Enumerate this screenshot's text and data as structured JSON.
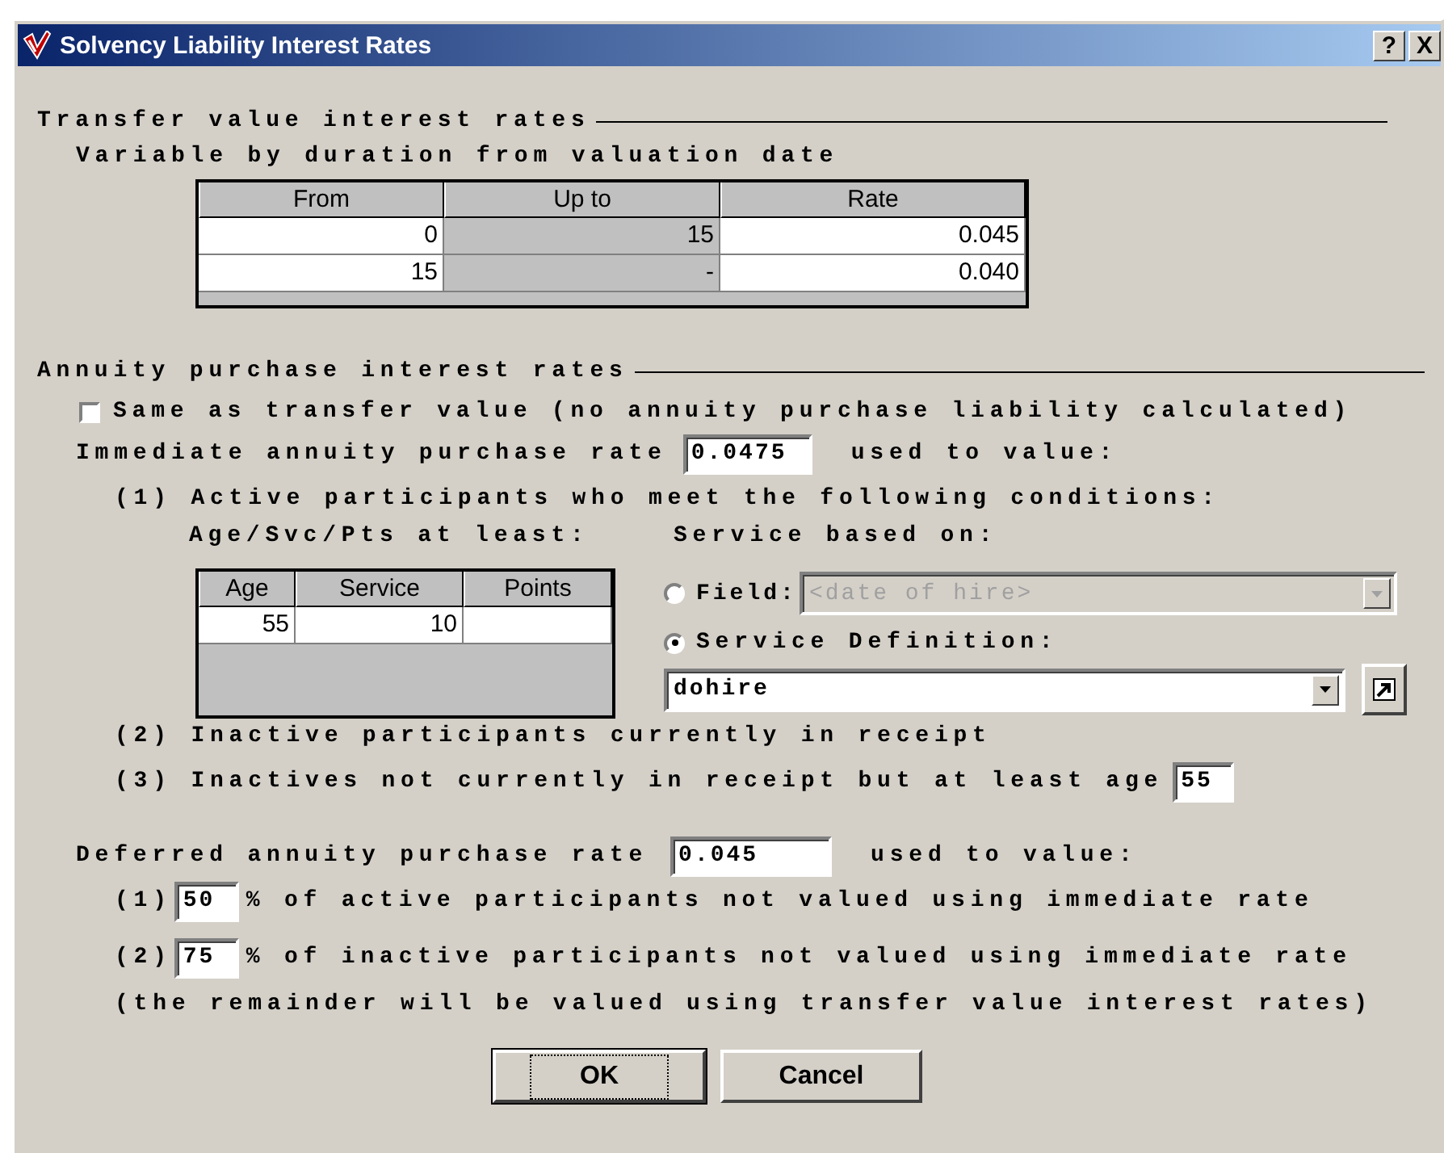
{
  "window": {
    "title": "Solvency Liability Interest Rates",
    "help_button": "?",
    "close_button": "X"
  },
  "transfer_section": {
    "heading": "Transfer value interest rates",
    "subheading": "Variable by duration from valuation date",
    "table": {
      "columns": [
        {
          "label": "From",
          "readonly": false
        },
        {
          "label": "Up to",
          "readonly": true
        },
        {
          "label": "Rate",
          "readonly": false
        }
      ],
      "rows": [
        [
          "0",
          "15",
          "0.045"
        ],
        [
          "15",
          "-",
          "0.040"
        ]
      ]
    }
  },
  "annuity_section": {
    "heading": "Annuity purchase interest rates",
    "same_as_transfer": {
      "label": "Same as transfer value (no annuity purchase liability calculated)",
      "checked": false
    },
    "immediate": {
      "label": "Immediate annuity purchase rate",
      "value": "0.0475",
      "suffix": "used to value:",
      "condition_1": "(1) Active participants who meet the following conditions:",
      "table_label": "Age/Svc/Pts at least:",
      "table": {
        "columns": [
          {
            "label": "Age",
            "readonly": false
          },
          {
            "label": "Service",
            "readonly": false
          },
          {
            "label": "Points",
            "readonly": false
          }
        ],
        "rows": [
          [
            "55",
            "10"
          ]
        ]
      },
      "service_label": "Service based on:",
      "service_options": [
        {
          "label": "Field:",
          "selected": false
        },
        {
          "label": "Service Definition:",
          "selected": true
        }
      ],
      "field_select": {
        "value": "<date of hire>",
        "disabled": true
      },
      "definition_select": {
        "value": "dohire",
        "disabled": false
      },
      "condition_2": "(2) Inactive participants currently in receipt",
      "condition_3": "(3) Inactives not currently in receipt but at least age",
      "min_age": "55"
    },
    "deferred": {
      "label": "Deferred annuity purchase rate",
      "value": "0.045",
      "suffix": "used to value:",
      "items": [
        {
          "number": "(1)",
          "value": "50",
          "text": "% of active participants not valued using immediate rate"
        },
        {
          "number": "(2)",
          "value": "75",
          "text": "% of inactive participants not valued using immediate rate"
        }
      ],
      "note": "(the remainder will be valued using transfer value interest rates)"
    }
  },
  "buttons": [
    {
      "label": "OK",
      "default": true
    },
    {
      "label": "Cancel",
      "default": false
    }
  ]
}
